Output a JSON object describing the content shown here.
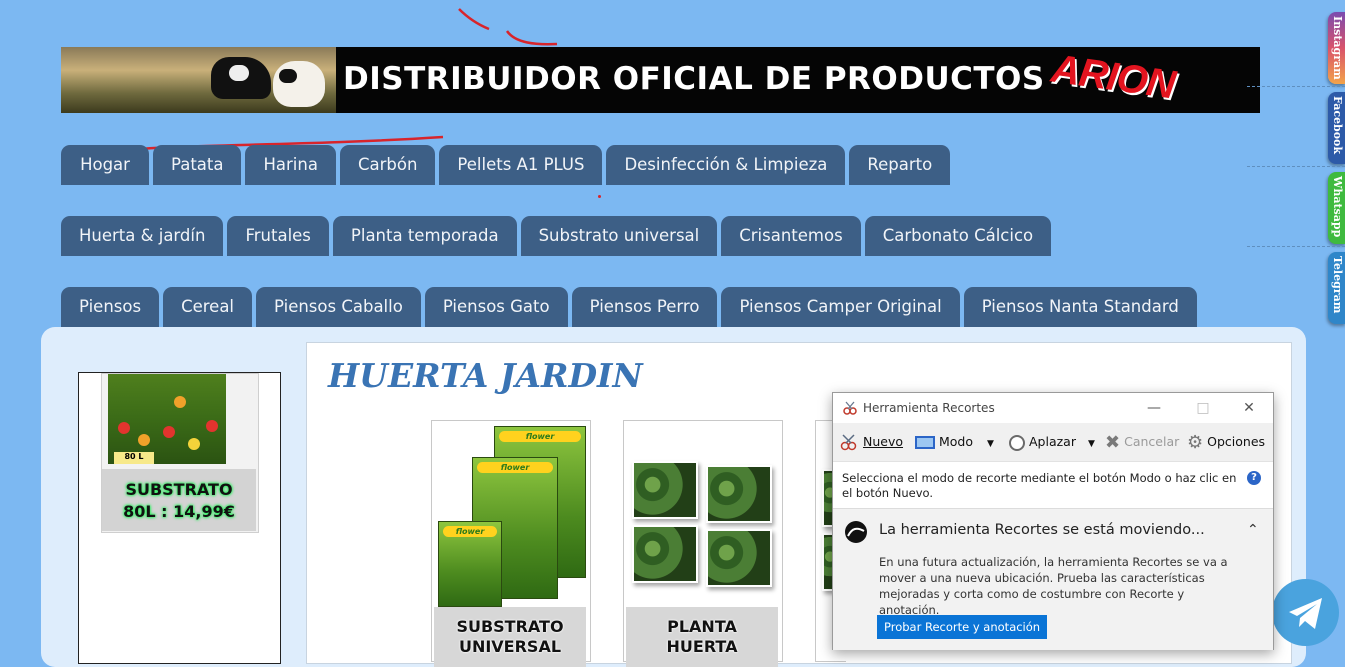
{
  "banner": {
    "title": "DISTRIBUIDOR OFICIAL DE PRODUCTOS",
    "brand_logo": "ARION"
  },
  "nav": {
    "row1": [
      "Hogar",
      "Patata",
      "Harina",
      "Carbón",
      "Pellets A1 PLUS",
      "Desinfección & Limpieza",
      "Reparto"
    ],
    "row2": [
      "Huerta & jardín",
      "Frutales",
      "Planta temporada",
      "Substrato universal",
      "Crisantemos",
      "Carbonato Cálcico"
    ],
    "row3": [
      "Piensos",
      "Cereal",
      "Piensos Caballo",
      "Piensos Gato",
      "Piensos Perro",
      "Piensos Camper Original",
      "Piensos Nanta Standard"
    ]
  },
  "sidebar": {
    "promo_line1": "SUBSTRATO",
    "promo_line2": "80L : 14,99€",
    "bag_label": "80 L"
  },
  "main": {
    "section_title": "HUERTA JARDIN",
    "products": [
      {
        "caption_line1": "SUBSTRATO",
        "caption_line2": "UNIVERSAL",
        "brand": "flower"
      },
      {
        "caption_line1": "PLANTA",
        "caption_line2": "HUERTA"
      }
    ]
  },
  "social_tabs": [
    {
      "label": "Instagram",
      "color": "#d9536b"
    },
    {
      "label": "Facebook",
      "color": "#2d5aa8"
    },
    {
      "label": "Whatsapp",
      "color": "#3fba3f"
    },
    {
      "label": "Telegram",
      "color": "#2f86c9"
    }
  ],
  "snipping_tool": {
    "title": "Herramienta Recortes",
    "toolbar": {
      "new": "Nuevo",
      "mode": "Modo",
      "delay": "Aplazar",
      "cancel": "Cancelar",
      "options": "Opciones"
    },
    "info": "Selecciona el modo de recorte mediante el botón Modo o haz clic en el botón Nuevo.",
    "notice_title": "La herramienta Recortes se está moviendo...",
    "notice_body": "En una futura actualización, la herramienta Recortes se va a mover a una nueva ubicación. Prueba las características mejoradas y corta como de costumbre con Recorte y anotación.",
    "notice_button": "Probar Recorte y anotación"
  },
  "colors": {
    "page_bg": "#7cb8f2",
    "tab_bg": "#3d5f86",
    "title_blue": "#3a74b4",
    "accent_button": "#0a74d6"
  }
}
